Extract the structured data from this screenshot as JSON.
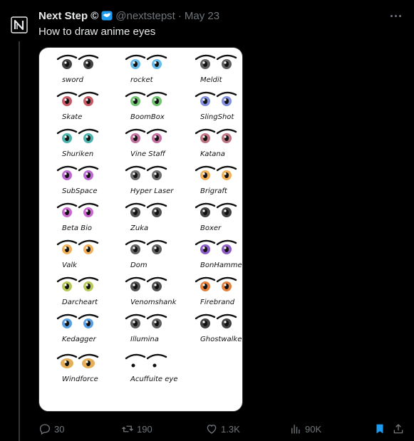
{
  "author": {
    "name": "Next Step",
    "name_suffix": "©",
    "handle": "@nextstepst",
    "date": "May 23",
    "separator": "·"
  },
  "tweet": {
    "text": "How to draw anime eyes"
  },
  "image": {
    "labels": [
      "sword",
      "rocket",
      "Meldit",
      "Skate",
      "BoomBox",
      "SlingShot",
      "Shuriken",
      "Vine Staff",
      "Katana",
      "SubSpace",
      "Hyper Laser",
      "Brigraft",
      "Beta Bio",
      "Zuka",
      "Boxer",
      "Valk",
      "Dom",
      "BonHammer",
      "Darcheart",
      "Venomshank",
      "Firebrand",
      "Kedagger",
      "Illumina",
      "Ghostwalker",
      "Windforce",
      "Acuffuite eye"
    ]
  },
  "actions": {
    "replies": "30",
    "retweets": "190",
    "likes": "1.3K",
    "views": "90K"
  },
  "colors": {
    "background": "#000000",
    "text": "#e7e9ea",
    "muted": "#71767b",
    "verified": "#1d9bf0",
    "bookmark": "#1d9bf0"
  }
}
